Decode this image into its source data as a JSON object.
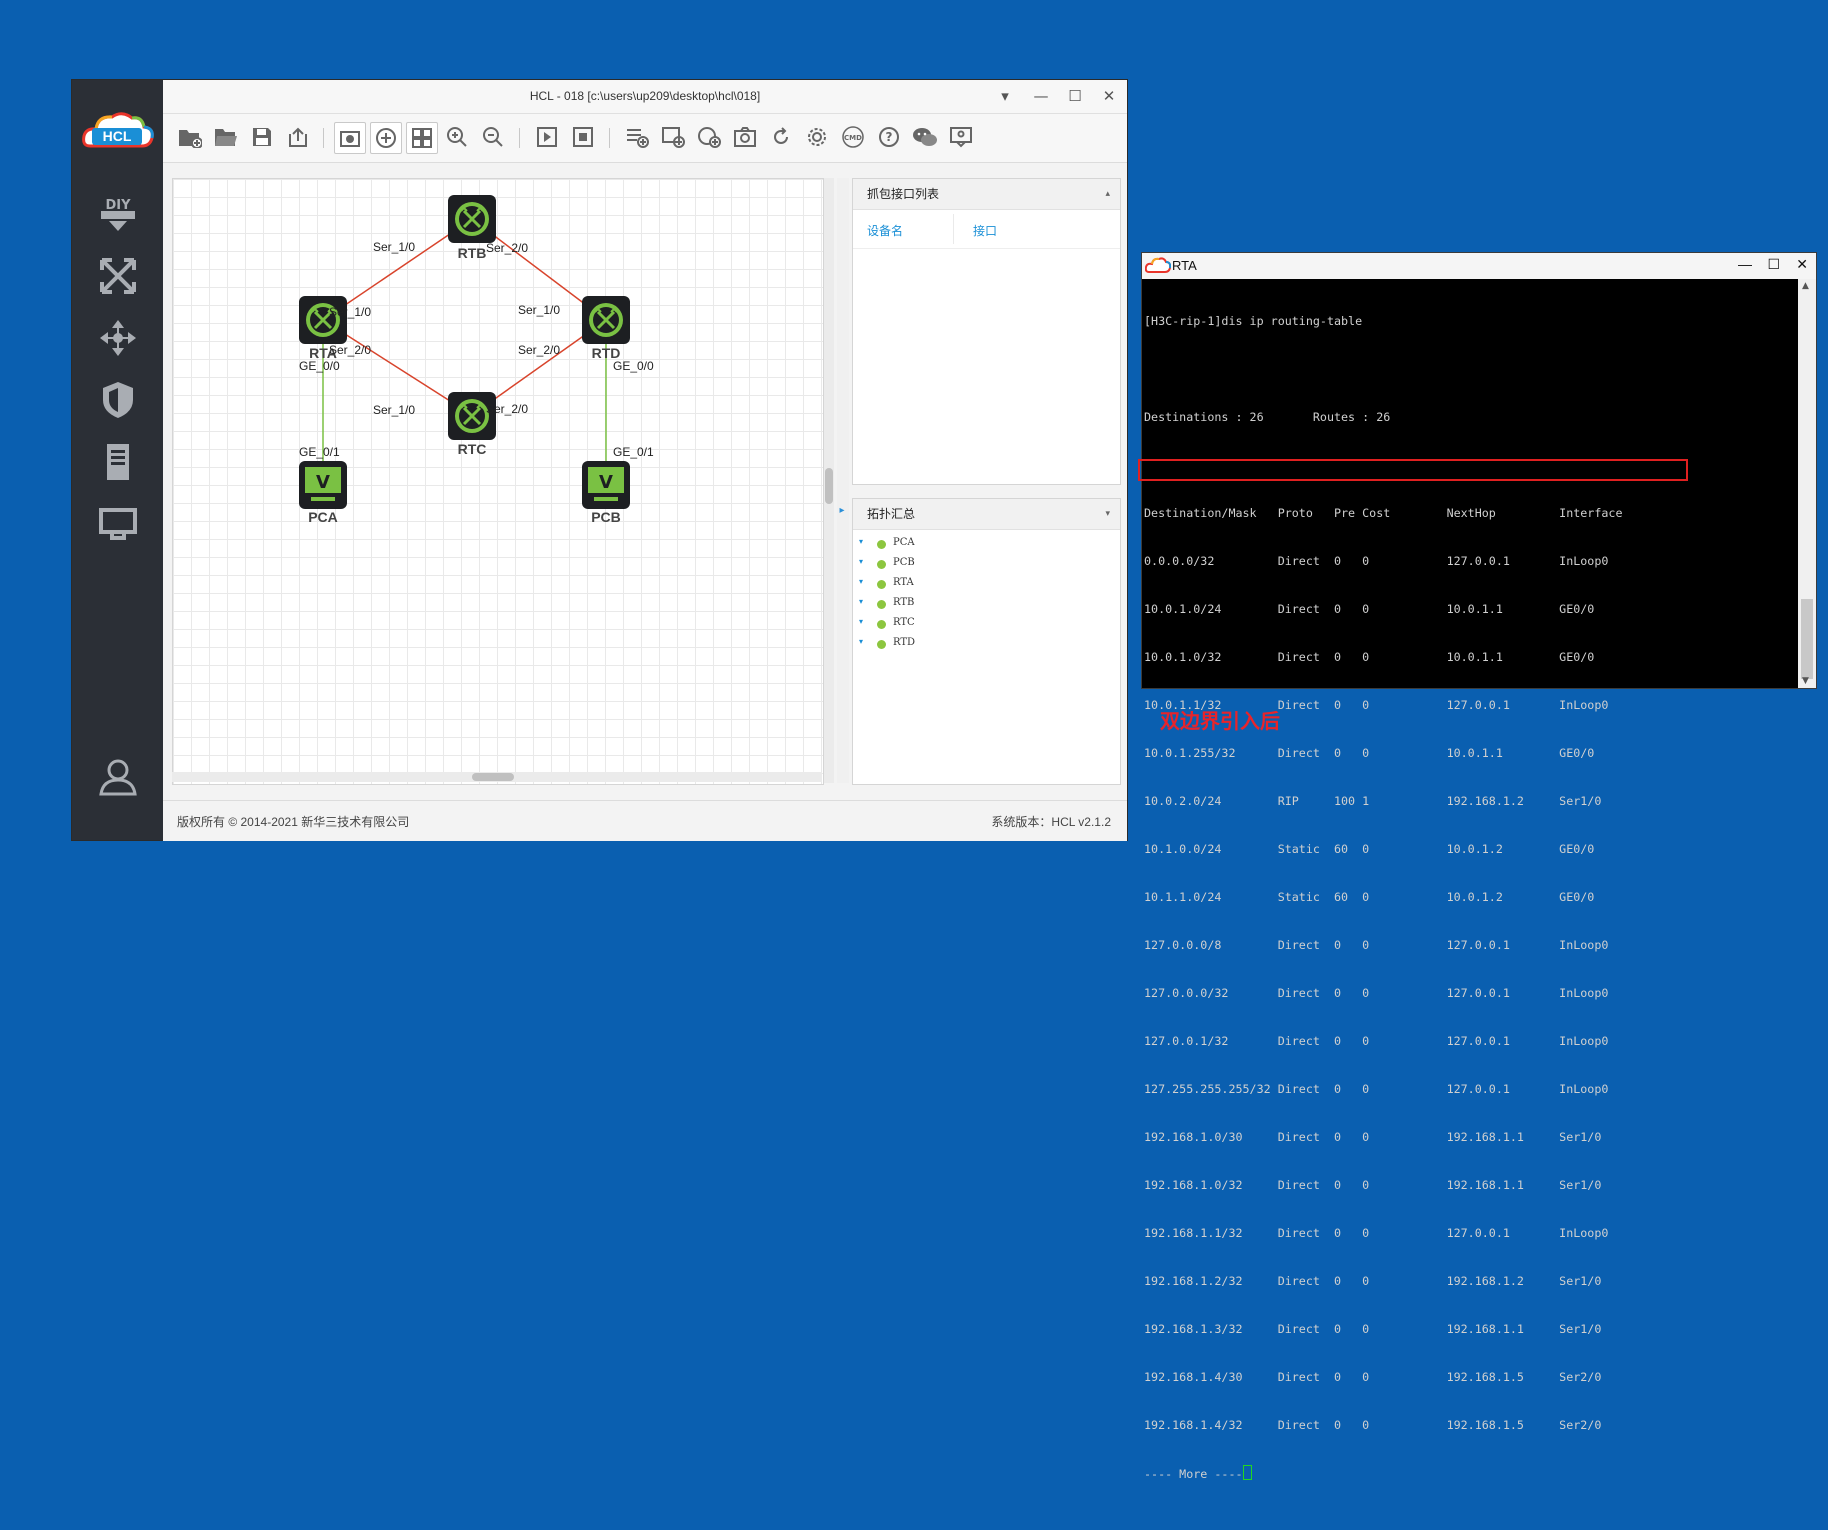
{
  "hcl": {
    "window_title": "HCL - 018 [c:\\users\\up209\\desktop\\hcl\\018]",
    "logo_text": "HCL",
    "leftbar_items": [
      "DIY",
      "topology",
      "move",
      "security",
      "server",
      "monitor",
      "user"
    ],
    "canvas": {
      "nodes": {
        "rtb": "RTB",
        "rta": "RTA",
        "rtd": "RTD",
        "rtc": "RTC",
        "pca": "PCA",
        "pcb": "PCB"
      },
      "ports": {
        "rtb_left": "Ser_1/0",
        "rtb_right": "Ser_2/0",
        "rta_top": "Ser_1/0",
        "rta_bottom": "Ser_2/0",
        "rta_ge": "GE_0/0",
        "rtd_top": "Ser_1/0",
        "rtd_bottom": "Ser_2/0",
        "rtd_ge": "GE_0/0",
        "rtc_left": "Ser_1/0",
        "rtc_right": "Ser_2/0",
        "pca_ge": "GE_0/1",
        "pcb_ge": "GE_0/1"
      }
    },
    "capture_panel": {
      "title": "抓包接口列表",
      "col_device": "设备名",
      "col_interface": "接口"
    },
    "topology_panel": {
      "title": "拓扑汇总",
      "items": [
        "PCA",
        "PCB",
        "RTA",
        "RTB",
        "RTC",
        "RTD"
      ]
    },
    "status": {
      "copyright": "版权所有 © 2014-2021 新华三技术有限公司",
      "version": "系统版本：HCL v2.1.2"
    }
  },
  "terminal": {
    "title": "RTA",
    "command": "[H3C-rip-1]dis ip routing-table",
    "summary": "Destinations : 26       Routes : 26",
    "header": "Destination/Mask   Proto   Pre Cost        NextHop         Interface",
    "rows": [
      "0.0.0.0/32         Direct  0   0           127.0.0.1       InLoop0",
      "10.0.1.0/24        Direct  0   0           10.0.1.1        GE0/0",
      "10.0.1.0/32        Direct  0   0           10.0.1.1        GE0/0",
      "10.0.1.1/32        Direct  0   0           127.0.0.1       InLoop0",
      "10.0.1.255/32      Direct  0   0           10.0.1.1        GE0/0",
      "10.0.2.0/24        RIP     100 1           192.168.1.2     Ser1/0",
      "10.1.0.0/24        Static  60  0           10.0.1.2        GE0/0",
      "10.1.1.0/24        Static  60  0           10.0.1.2        GE0/0",
      "127.0.0.0/8        Direct  0   0           127.0.0.1       InLoop0",
      "127.0.0.0/32       Direct  0   0           127.0.0.1       InLoop0",
      "127.0.0.1/32       Direct  0   0           127.0.0.1       InLoop0",
      "127.255.255.255/32 Direct  0   0           127.0.0.1       InLoop0",
      "192.168.1.0/30     Direct  0   0           192.168.1.1     Ser1/0",
      "192.168.1.0/32     Direct  0   0           192.168.1.1     Ser1/0",
      "192.168.1.1/32     Direct  0   0           127.0.0.1       InLoop0",
      "192.168.1.2/32     Direct  0   0           192.168.1.2     Ser1/0",
      "192.168.1.3/32     Direct  0   0           192.168.1.1     Ser1/0",
      "192.168.1.4/30     Direct  0   0           192.168.1.5     Ser2/0",
      "192.168.1.4/32     Direct  0   0           192.168.1.5     Ser2/0"
    ],
    "more_prompt": "---- More ----"
  },
  "annotation": "双边界引入后",
  "colors": {
    "background": "#0a5fb0",
    "serial_link": "#d8442c",
    "ethernet_link": "#7ac143",
    "highlight": "#e02020",
    "accent": "#1a8fd6"
  }
}
